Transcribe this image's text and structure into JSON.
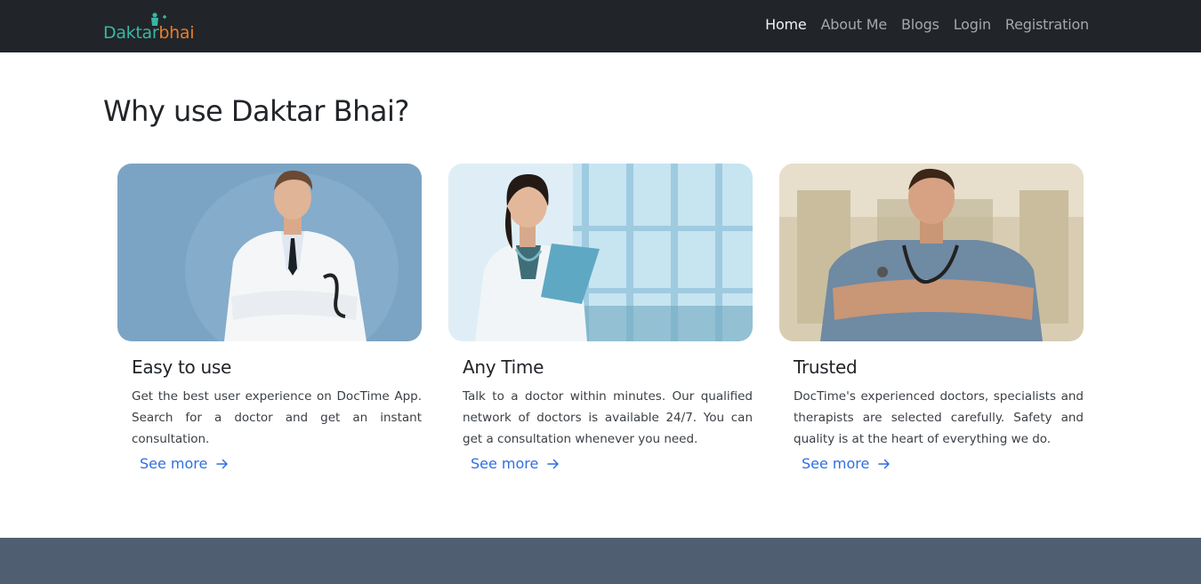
{
  "brand": {
    "part1": "Daktar",
    "part2": "bhai"
  },
  "nav": {
    "items": [
      {
        "label": "Home",
        "active": true
      },
      {
        "label": "About Me",
        "active": false
      },
      {
        "label": "Blogs",
        "active": false
      },
      {
        "label": "Login",
        "active": false
      },
      {
        "label": "Registration",
        "active": false
      }
    ]
  },
  "section": {
    "title": "Why use Daktar Bhai?"
  },
  "cards": [
    {
      "title": "Easy to use",
      "text": "Get the best user experience on DocTime App. Search for a doctor and get an instant consultation.",
      "link": "See more"
    },
    {
      "title": "Any Time",
      "text": "Talk to a doctor within minutes. Our qualified network of doctors is available 24/7. You can get a consultation whenever you need.",
      "link": "See more"
    },
    {
      "title": "Trusted",
      "text": "DocTime's experienced doctors, specialists and therapists are selected carefully. Safety and quality is at the heart of everything we do.",
      "link": "See more"
    }
  ],
  "colors": {
    "navbar": "#212529",
    "link": "#2f6fe0",
    "footer": "#4f5f71",
    "brand_primary": "#3bb5a5",
    "brand_accent": "#e87c2a"
  }
}
